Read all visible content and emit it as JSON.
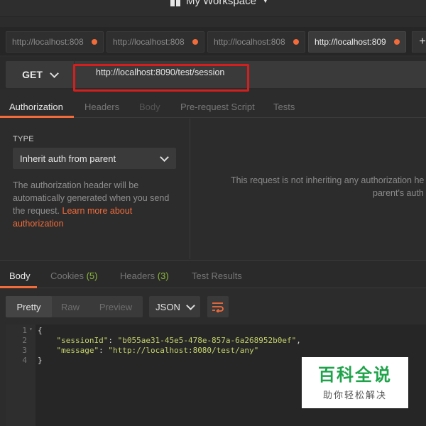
{
  "workspace": {
    "title": "My Workspace"
  },
  "tabs": [
    {
      "label": "http://localhost:808",
      "active": false
    },
    {
      "label": "http://localhost:808",
      "active": false
    },
    {
      "label": "http://localhost:808",
      "active": false
    },
    {
      "label": "http://localhost:809",
      "active": true
    }
  ],
  "tab_plus": "+",
  "request": {
    "method": "GET",
    "url": "http://localhost:8090/test/session"
  },
  "request_tabs": [
    {
      "label": "Authorization",
      "state": "active"
    },
    {
      "label": "Headers",
      "state": "normal"
    },
    {
      "label": "Body",
      "state": "disabled"
    },
    {
      "label": "Pre-request Script",
      "state": "normal"
    },
    {
      "label": "Tests",
      "state": "normal"
    }
  ],
  "auth": {
    "type_label": "TYPE",
    "selected_type": "Inherit auth from parent",
    "description": "The authorization header will be automatically generated when you send the request. ",
    "link_text": "Learn more about authorization",
    "inherit_message_line1": "This request is not inheriting any authorization he",
    "inherit_message_line2": "parent's auth"
  },
  "response_tabs": [
    {
      "label": "Body",
      "count": "",
      "active": true
    },
    {
      "label": "Cookies",
      "count": "(5)",
      "active": false
    },
    {
      "label": "Headers",
      "count": "(3)",
      "active": false
    },
    {
      "label": "Test Results",
      "count": "",
      "active": false
    }
  ],
  "view_modes": [
    "Pretty",
    "Raw",
    "Preview"
  ],
  "format": "JSON",
  "code": {
    "line_numbers": [
      "1",
      "2",
      "3",
      "4"
    ],
    "line1": "{",
    "key1": "\"sessionId\"",
    "val1": "\"b055ae31-45e5-478e-857a-6a268952b0ef\"",
    "key2": "\"message\"",
    "val2": "\"http://localhost:8080/test/any\"",
    "line4": "}"
  },
  "watermark": {
    "title": "百科全说",
    "subtitle": "助你轻松解决"
  },
  "colors": {
    "accent": "#f26b3a",
    "highlight": "#d41f1f",
    "count_green": "#8dbb3c"
  }
}
